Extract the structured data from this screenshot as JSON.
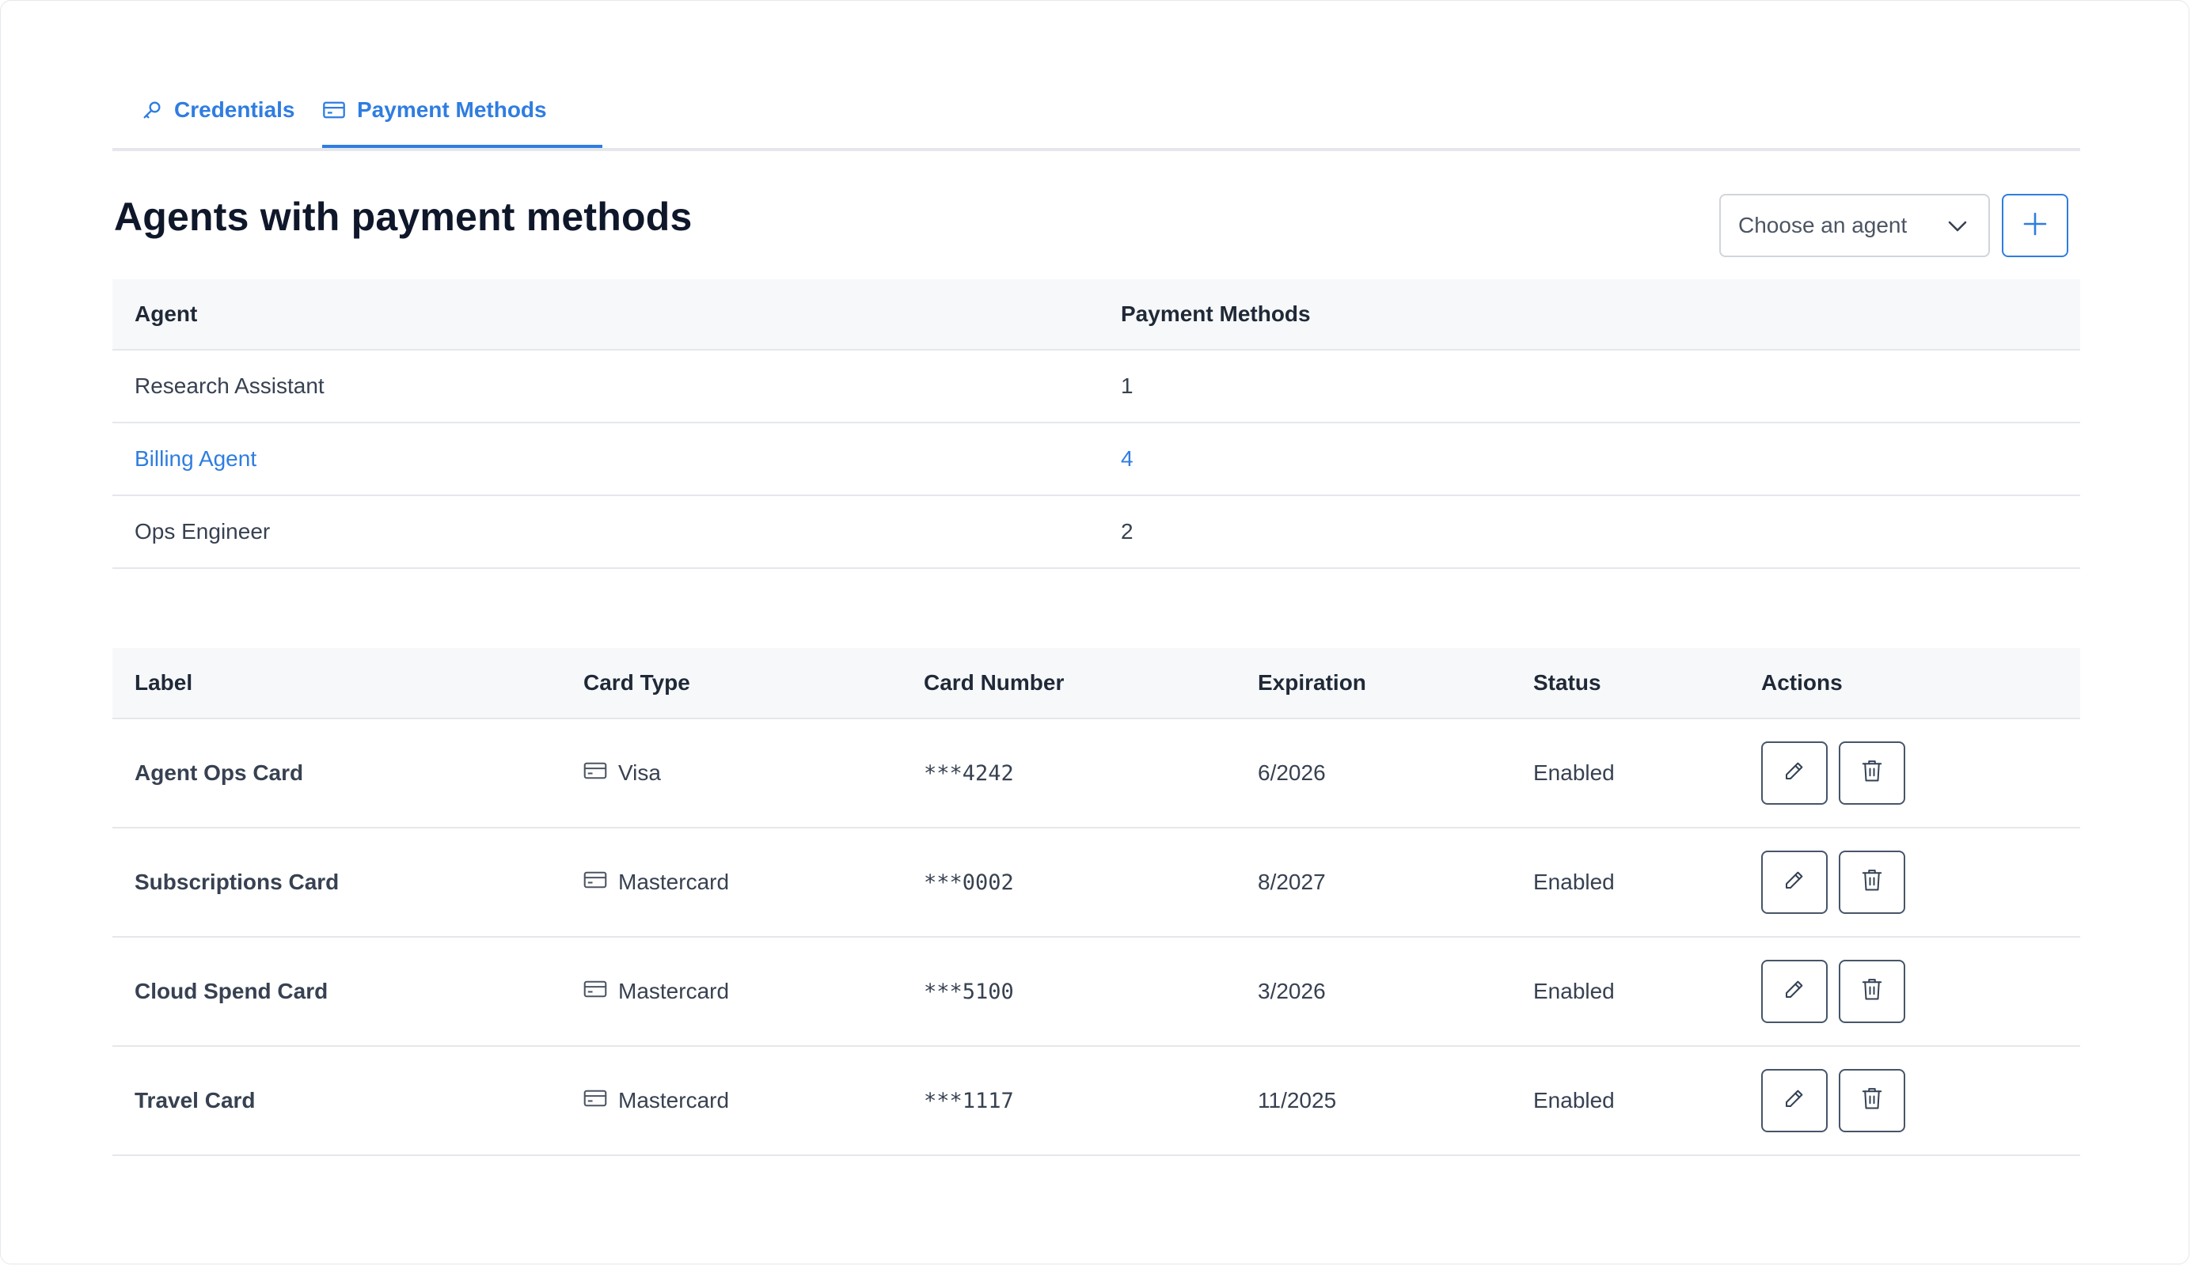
{
  "tabs": [
    {
      "label": "Credentials",
      "icon": "key-icon",
      "active": false
    },
    {
      "label": "Payment Methods",
      "icon": "credit-card-icon",
      "active": true
    }
  ],
  "page": {
    "title": "Agents with payment methods"
  },
  "agent_select": {
    "placeholder": "Choose an agent",
    "icon": "chevron-down-icon"
  },
  "add_button": {
    "icon": "plus-icon"
  },
  "agents_table": {
    "columns": [
      "Agent",
      "Payment Methods"
    ],
    "rows": [
      {
        "agent": "Research Assistant",
        "count": "1",
        "highlighted": false
      },
      {
        "agent": "Billing Agent",
        "count": "4",
        "highlighted": true
      },
      {
        "agent": "Ops Engineer",
        "count": "2",
        "highlighted": false
      }
    ]
  },
  "cards_table": {
    "columns": [
      "Label",
      "Card Type",
      "Card Number",
      "Expiration",
      "Status",
      "Actions"
    ],
    "rows": [
      {
        "label": "Agent Ops Card",
        "card_type": "Visa",
        "card_number": "***4242",
        "expiration": "6/2026",
        "status": "Enabled"
      },
      {
        "label": "Subscriptions Card",
        "card_type": "Mastercard",
        "card_number": "***0002",
        "expiration": "8/2027",
        "status": "Enabled"
      },
      {
        "label": "Cloud Spend Card",
        "card_type": "Mastercard",
        "card_number": "***5100",
        "expiration": "3/2026",
        "status": "Enabled"
      },
      {
        "label": "Travel Card",
        "card_type": "Mastercard",
        "card_number": "***1117",
        "expiration": "11/2025",
        "status": "Enabled"
      }
    ],
    "row_actions": [
      "edit-icon",
      "trash-icon"
    ]
  },
  "colors": {
    "accent": "#2f7de1",
    "header_bg": "#f7f8fa",
    "border": "#e5e7eb",
    "title": "#0f172a"
  }
}
